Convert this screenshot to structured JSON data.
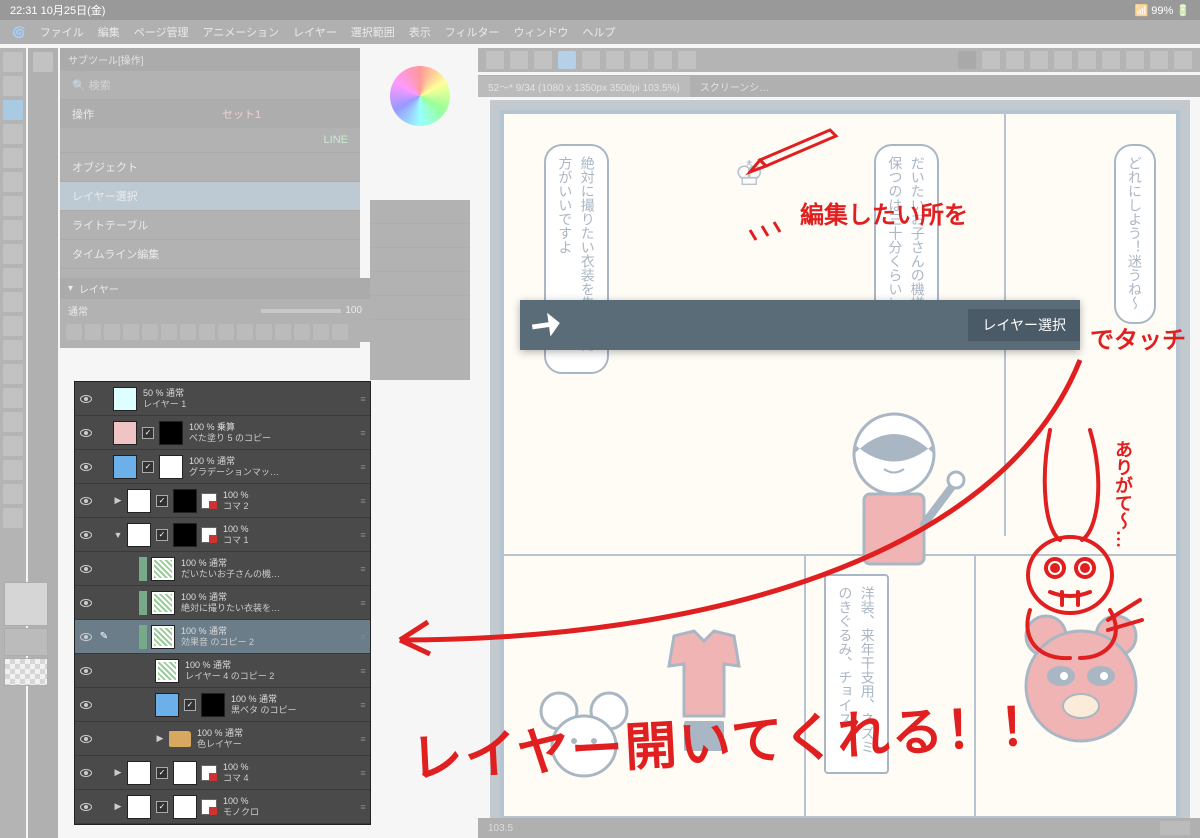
{
  "status_bar": {
    "time": "22:31",
    "date": "10月25日(金)",
    "battery": "99%"
  },
  "menu": {
    "items": [
      "ファイル",
      "編集",
      "ページ管理",
      "アニメーション",
      "レイヤー",
      "選択範囲",
      "表示",
      "フィルター",
      "ウィンドウ",
      "ヘルプ"
    ]
  },
  "doc": {
    "active_tab": "52～* 9/34 (1080 x 1350px 350dpi 103.5%)",
    "inactive_tab": "スクリーンシ…"
  },
  "subtool": {
    "header_title": "サブツール[操作]",
    "search_placeholder": "検索",
    "tab1": "操作",
    "tab2": "セット1",
    "line_label": "LINE",
    "rows": [
      "オブジェクト",
      "レイヤー選択",
      "ライトテーブル",
      "タイムライン編集"
    ]
  },
  "layer_header": {
    "title": "レイヤー",
    "blend_mode": "通常",
    "opacity": "100"
  },
  "layers": [
    {
      "opacity": "50 % 通常",
      "name": "レイヤー 1",
      "thumb": "green"
    },
    {
      "opacity": "100 % 乗算",
      "name": "べた塗り 5 のコピー",
      "thumb": "pink",
      "mask": true,
      "chk": true
    },
    {
      "opacity": "100 % 通常",
      "name": "グラデーションマッ…",
      "thumb": "bluebox",
      "mask2": true,
      "chk": true
    },
    {
      "opacity": "100 %",
      "name": "コマ 2",
      "folder": true,
      "arrow": "▶",
      "chk": true,
      "maskicon": true
    },
    {
      "opacity": "100 %",
      "name": "コマ 1",
      "folder": true,
      "arrow": "▼",
      "chk": true,
      "maskicon": true
    },
    {
      "opacity": "100 % 通常",
      "name": "だいたいお子さんの機…",
      "thumb": "art",
      "indent": 2,
      "badge": true
    },
    {
      "opacity": "100 % 通常",
      "name": "絶対に撮りたい衣装を…",
      "thumb": "art",
      "indent": 2,
      "badge": true
    },
    {
      "opacity": "100 % 通常",
      "name": "効果音 のコピー 2",
      "thumb": "art",
      "indent": 2,
      "badge": true,
      "selected": true
    },
    {
      "opacity": "100 % 通常",
      "name": "レイヤー 4 のコピー 2",
      "thumb": "art",
      "indent": 3
    },
    {
      "opacity": "100 % 通常",
      "name": "黒ベタ のコピー",
      "thumb": "bluebox",
      "indent": 3,
      "mask": true,
      "chk": true
    },
    {
      "opacity": "100 % 通常",
      "name": "色レイヤー",
      "indent": 3,
      "arrow": "▶",
      "folderonly": true
    },
    {
      "opacity": "100 %",
      "name": "コマ 4",
      "folder": true,
      "arrow": "▶",
      "chk": true,
      "maskicon": true
    },
    {
      "opacity": "100 %",
      "name": "モノクロ",
      "folder": true,
      "arrow": "▶",
      "chk": true,
      "maskicon": true
    }
  ],
  "tooltip": {
    "label": "レイヤー選択"
  },
  "speech": {
    "b1": "絶対に撮りたい衣装を先にした方がいいですよ",
    "b2": "だいたいお子さんの機嫌が保つのは三十分くらい…",
    "b3": "どれにしよう！迷うね〜",
    "b4": "洋装、来年干支用、ネズミのきぐるみ、チョイス",
    "crown": "♔"
  },
  "annotations": {
    "big": "レイヤー開いてくれる！！",
    "line1": "編集したい所を",
    "line2": "でタッチ",
    "thanks": "ありがて〜…"
  },
  "status": {
    "zoom": "103.5"
  },
  "colors": {
    "annotation_red": "#e02020",
    "tooltip_bg": "#5a6c78",
    "selected_layer": "#6b7d88"
  }
}
